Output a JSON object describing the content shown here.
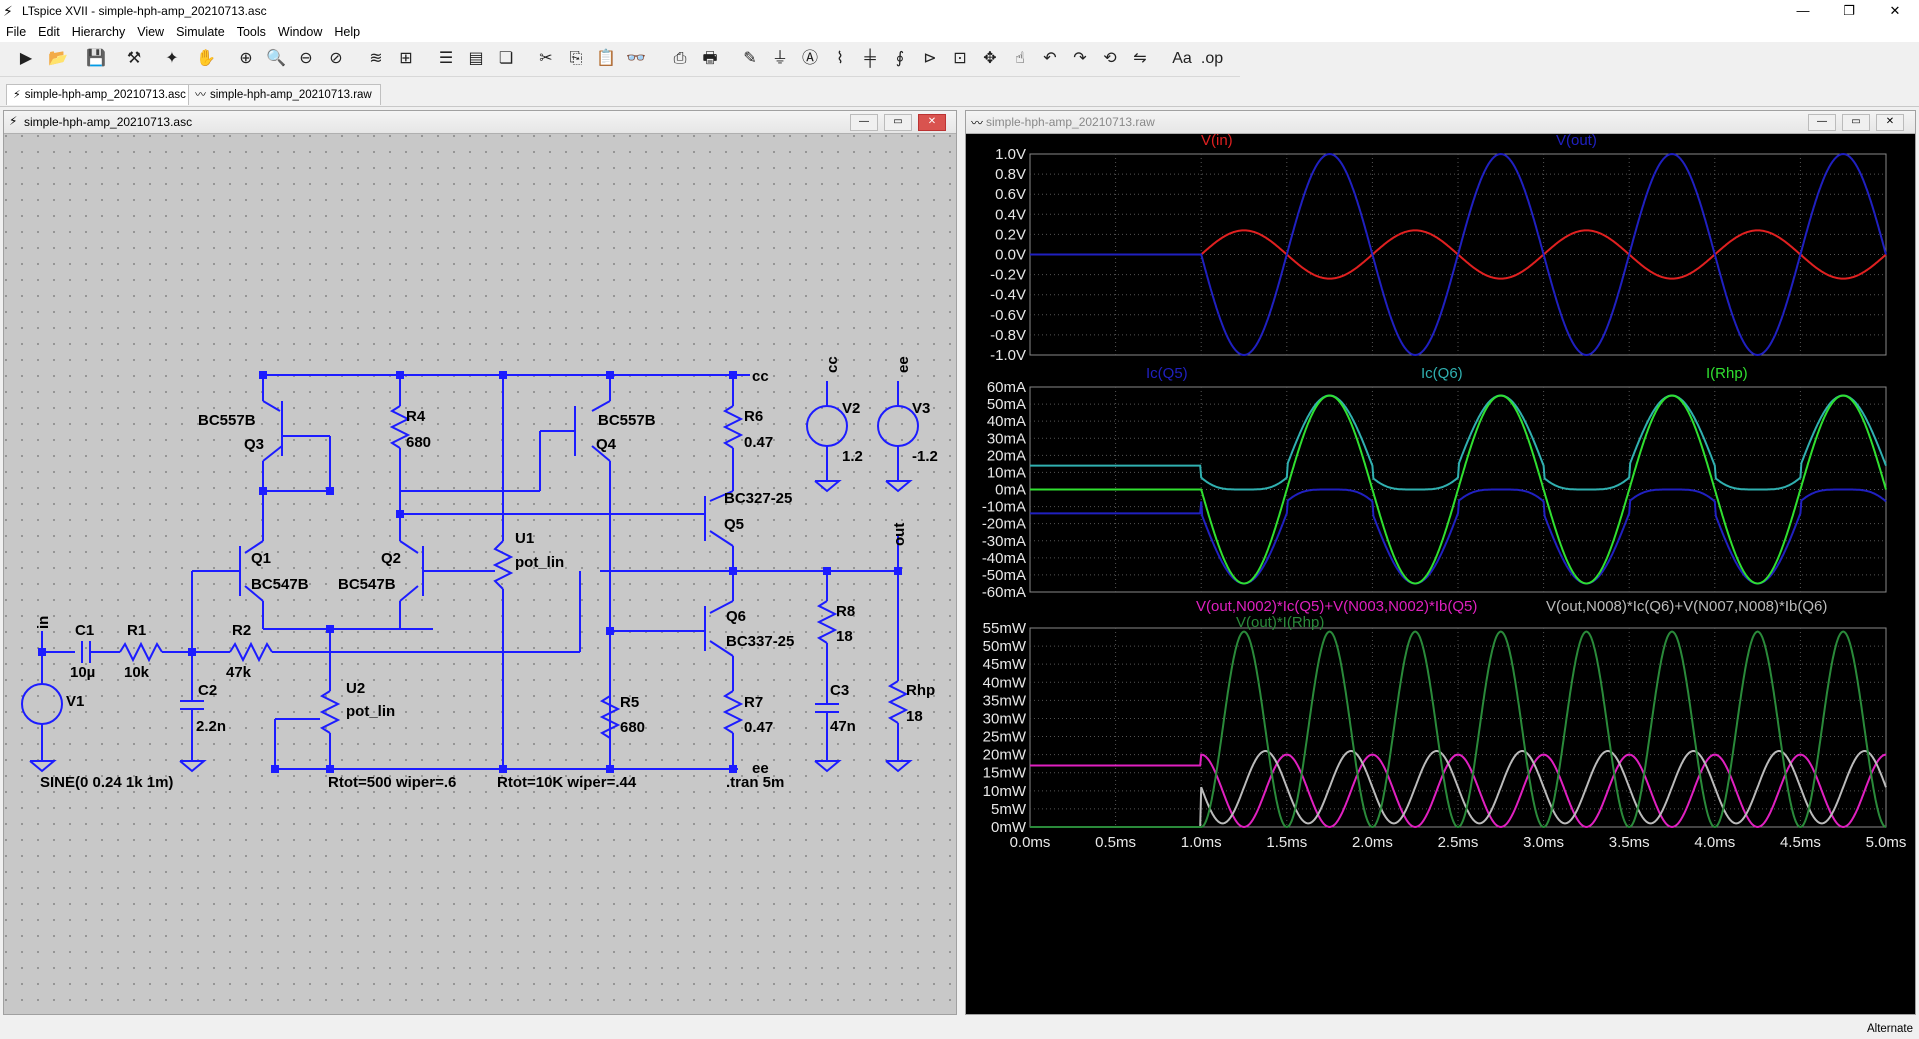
{
  "app": {
    "title": "LTspice XVII - simple-hph-amp_20210713.asc"
  },
  "menu": [
    "File",
    "Edit",
    "Hierarchy",
    "View",
    "Simulate",
    "Tools",
    "Window",
    "Help"
  ],
  "tabs": [
    {
      "label": "simple-hph-amp_20210713.asc",
      "icon": "schematic-icon"
    },
    {
      "label": "simple-hph-amp_20210713.raw",
      "icon": "waveform-icon"
    }
  ],
  "schematic_window": {
    "title": "simple-hph-amp_20210713.asc",
    "labels": {
      "q3_type": "BC557B",
      "q3": "Q3",
      "r4": "R4",
      "r4_val": "680",
      "q4_type": "BC557B",
      "q4": "Q4",
      "r6": "R6",
      "r6_val": "0.47",
      "net_cc": "cc",
      "net_ee_top": "ee",
      "v2": "V2",
      "v2_val": "1.2",
      "v3": "V3",
      "v3_val": "-1.2",
      "q1": "Q1",
      "q1_type": "BC547B",
      "q2": "Q2",
      "q2_type": "BC547B",
      "u1": "U1",
      "u1_type": "pot_lin",
      "q5_type": "BC327-25",
      "q5": "Q5",
      "net_out": "out",
      "q6": "Q6",
      "q6_type": "BC337-25",
      "r8": "R8",
      "r8_val": "18",
      "net_in": "in",
      "c1": "C1",
      "c1_val": "10µ",
      "r1": "R1",
      "r1_val": "10k",
      "r2": "R2",
      "r2_val": "47k",
      "v1": "V1",
      "c2": "C2",
      "c2_val": "2.2n",
      "u2": "U2",
      "u2_type": "pot_lin",
      "r5": "R5",
      "r5_val": "680",
      "r7": "R7",
      "r7_val": "0.47",
      "c3": "C3",
      "c3_val": "47n",
      "rhp": "Rhp",
      "rhp_val": "18",
      "net_ee_bot": "ee",
      "sine": "SINE(0 0.24 1k 1m)",
      "u2_params": "Rtot=500 wiper=.6",
      "u1_params": "Rtot=10K wiper=.44",
      "tran": ".tran 5m"
    }
  },
  "waveform_window": {
    "title": "simple-hph-amp_20210713.raw",
    "pane1": {
      "traces": [
        {
          "name": "V(in)",
          "color": "#e02020"
        },
        {
          "name": "V(out)",
          "color": "#2020c0"
        }
      ],
      "yticks": [
        "1.0V",
        "0.8V",
        "0.6V",
        "0.4V",
        "0.2V",
        "0.0V",
        "-0.2V",
        "-0.4V",
        "-0.6V",
        "-0.8V",
        "-1.0V"
      ]
    },
    "pane2": {
      "traces": [
        {
          "name": "Ic(Q5)",
          "color": "#2020c0"
        },
        {
          "name": "Ic(Q6)",
          "color": "#30b0b0"
        },
        {
          "name": "I(Rhp)",
          "color": "#30e030"
        }
      ],
      "yticks": [
        "60mA",
        "50mA",
        "40mA",
        "30mA",
        "20mA",
        "10mA",
        "0mA",
        "-10mA",
        "-20mA",
        "-30mA",
        "-40mA",
        "-50mA",
        "-60mA"
      ]
    },
    "pane3": {
      "traces": [
        {
          "name": "V(out,N002)*Ic(Q5)+V(N003,N002)*Ib(Q5)",
          "color": "#e020c0"
        },
        {
          "name": "V(out,N008)*Ic(Q6)+V(N007,N008)*Ib(Q6)",
          "color": "#bbbbbb"
        },
        {
          "name": "V(out)*I(Rhp)",
          "color": "#2a8a3a"
        }
      ],
      "yticks": [
        "55mW",
        "50mW",
        "45mW",
        "40mW",
        "35mW",
        "30mW",
        "25mW",
        "20mW",
        "15mW",
        "10mW",
        "5mW",
        "0mW"
      ]
    },
    "xticks": [
      "0.0ms",
      "0.5ms",
      "1.0ms",
      "1.5ms",
      "2.0ms",
      "2.5ms",
      "3.0ms",
      "3.5ms",
      "4.0ms",
      "4.5ms",
      "5.0ms"
    ]
  },
  "chart_data": [
    {
      "type": "line",
      "title": "",
      "xlabel": "",
      "ylabel": "",
      "xlim": [
        0,
        5
      ],
      "ylim": [
        -1.0,
        1.0
      ],
      "series": [
        {
          "name": "V(in)",
          "x": [
            0,
            1,
            1.25,
            1.5,
            1.75,
            2,
            5
          ],
          "values": [
            0,
            0,
            0.24,
            0,
            -0.24,
            0,
            0
          ],
          "description_free": "0.24 V amplitude 1 kHz sine starting at 1.0 ms"
        },
        {
          "name": "V(out)",
          "x": [
            0,
            1,
            1.25,
            1.5,
            1.75,
            2
          ],
          "values": [
            0,
            0,
            -1.0,
            0,
            1.0,
            0
          ]
        }
      ]
    },
    {
      "type": "line",
      "xlim": [
        0,
        5
      ],
      "ylim": [
        -60,
        60
      ],
      "yunit": "mA",
      "series": [
        {
          "name": "Ic(Q5)",
          "x": [
            0,
            1,
            1.25,
            1.75
          ],
          "values": [
            -14,
            -14,
            -55,
            0
          ]
        },
        {
          "name": "Ic(Q6)",
          "x": [
            0,
            1,
            1.25,
            1.75
          ],
          "values": [
            14,
            14,
            55,
            0
          ]
        },
        {
          "name": "I(Rhp)",
          "x": [
            0,
            1,
            1.25,
            1.75
          ],
          "values": [
            0,
            0,
            -55,
            55
          ]
        }
      ]
    },
    {
      "type": "line",
      "xlim": [
        0,
        5
      ],
      "ylim": [
        0,
        55
      ],
      "yunit": "mW",
      "series": [
        {
          "name": "V(out,N002)*Ic(Q5)+V(N003,N002)*Ib(Q5)",
          "x": [
            0,
            1
          ],
          "values": [
            17,
            17
          ]
        },
        {
          "name": "V(out,N008)*Ic(Q6)+V(N007,N008)*Ib(Q6)",
          "x": [
            0,
            1
          ],
          "values": [
            0,
            0
          ]
        },
        {
          "name": "V(out)*I(Rhp)",
          "x": [
            0,
            1,
            1.25
          ],
          "values": [
            0,
            0,
            54
          ]
        }
      ]
    }
  ],
  "status": {
    "right": "Alternate"
  }
}
